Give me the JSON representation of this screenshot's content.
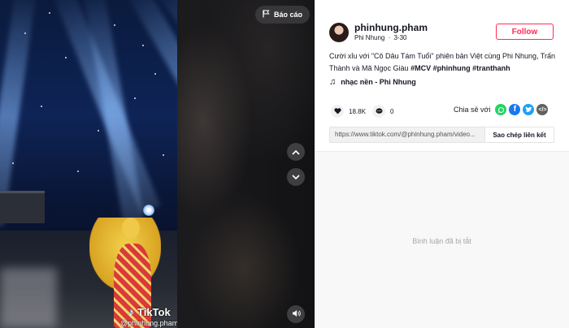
{
  "player": {
    "report_label": "Báo cáo",
    "watermark_brand": "TikTok",
    "watermark_handle": "@phinhung.pham",
    "icons": {
      "report": "flag-icon",
      "up": "chevron-up-icon",
      "down": "chevron-down-icon",
      "mute": "speaker-icon"
    }
  },
  "author": {
    "username": "phinhung.pham",
    "display_name": "Phi Nhung",
    "date": "3-30",
    "follow_label": "Follow"
  },
  "caption": {
    "text": "Cười xỉu với \"Cô Dâu Tám Tuổi\" phiên bản Việt cùng Phi Nhung, Trấn Thành và Mã Ngọc Giàu",
    "hashtags": [
      "#MCV",
      "#phinhung",
      "#tranthanh"
    ]
  },
  "music": {
    "label": "nhạc nền - Phi Nhung",
    "icon": "music-note-icon"
  },
  "stats": {
    "likes": "18.8K",
    "comments": "0",
    "icons": {
      "likes": "heart-icon",
      "comments": "comment-icon"
    }
  },
  "share": {
    "label": "Chia sẻ với",
    "targets": [
      "whatsapp-icon",
      "facebook-icon",
      "twitter-icon",
      "embed-icon"
    ],
    "colors": {
      "whatsapp": "#25d366",
      "facebook": "#1877f2",
      "twitter": "#1da1f2",
      "embed": "#616161"
    }
  },
  "link": {
    "url": "https://www.tiktok.com/@phinhung.pham/video...",
    "copy_label": "Sao chép liên kết"
  },
  "comments_area": {
    "disabled_text": "Bình luận đã bị tắt"
  },
  "colors": {
    "accent": "#fe2c55",
    "text": "#161823"
  }
}
